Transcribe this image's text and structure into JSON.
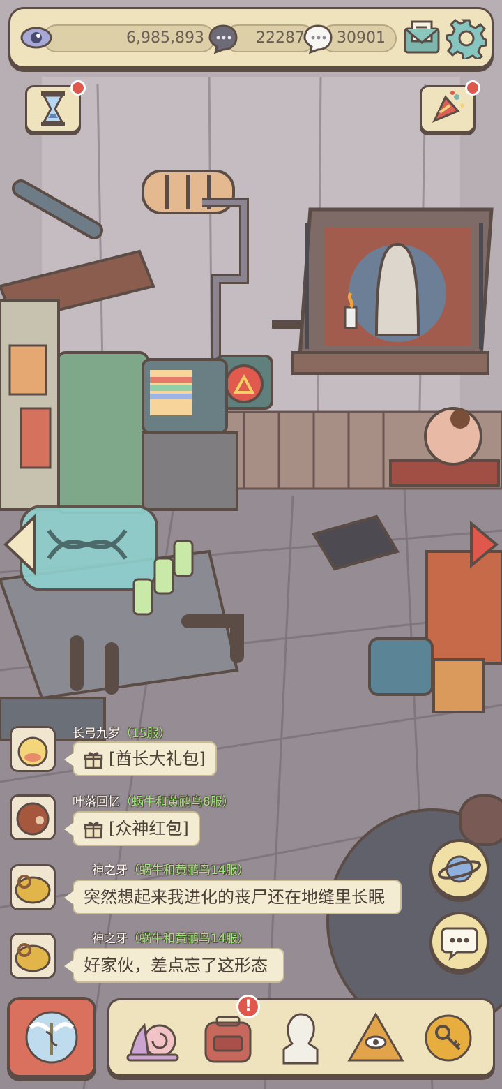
{
  "resources": {
    "eye_count": "6,985,893",
    "gray_bubble_count": "22287",
    "white_bubble_count": "30901"
  },
  "chat": {
    "messages": [
      {
        "name": "长弓九岁",
        "server": "（15服）",
        "text": "[酋长大礼包]",
        "type": "gift"
      },
      {
        "name": "叶落回忆",
        "server": "（蜗牛和黄鹂鸟8服）",
        "text": "[众神红包]",
        "type": "gift"
      },
      {
        "name": "神之牙",
        "server": "（蜗牛和黄鹂鸟14服）",
        "text": "突然想起来我进化的丧尸还在地缝里长眠",
        "type": "text"
      },
      {
        "name": "神之牙",
        "server": "（蜗牛和黄鹂鸟14服）",
        "text": "好家伙，差点忘了这形态",
        "type": "text"
      }
    ]
  },
  "icons": {
    "top": [
      "eye-icon",
      "gray-bubble-icon",
      "white-bubble-icon",
      "mail-icon",
      "settings-gear-icon"
    ],
    "corners": [
      "hourglass-icon",
      "party-popper-icon"
    ],
    "side": [
      "planet-icon",
      "chat-icon"
    ],
    "nav": [
      "caduceus-wings-icon",
      "snail-icon",
      "backpack-icon",
      "statue-bust-icon",
      "pyramid-eye-icon",
      "key-coin-icon"
    ]
  },
  "colors": {
    "panel": "#efe3bd",
    "outline": "#5b4c45",
    "badge_red": "#e0574c",
    "server_green": "#9fe37c"
  }
}
